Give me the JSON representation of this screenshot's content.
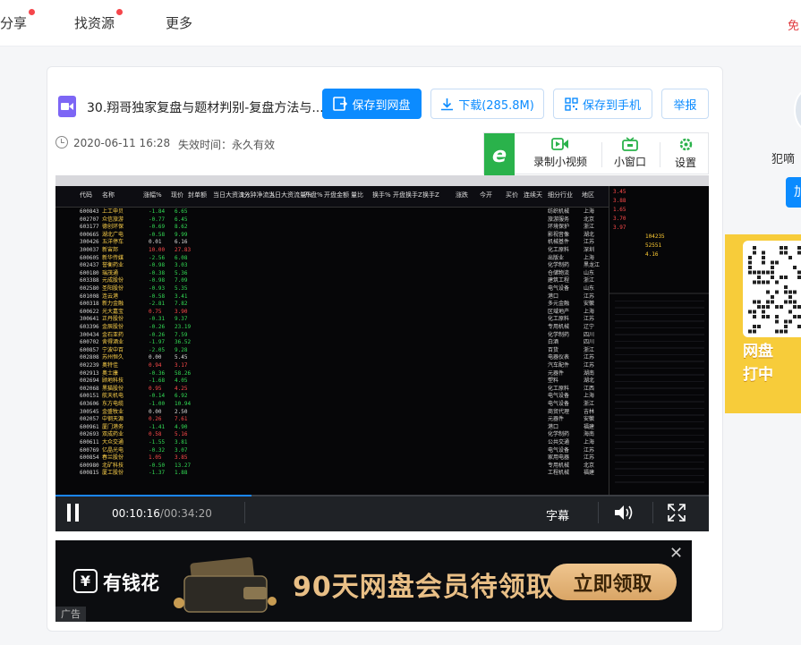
{
  "topnav": {
    "items": [
      {
        "label": "分享",
        "dot": true
      },
      {
        "label": "找资源",
        "dot": true
      },
      {
        "label": "更多",
        "dot": false
      }
    ],
    "right_link": "免"
  },
  "file": {
    "title": "30.翔哥独家复盘与题材判别-复盘方法与...",
    "date": "2020-06-11 16:28",
    "expiry": "失效时间：永久有效"
  },
  "actions": {
    "save_to_pan": "保存到网盘",
    "download": "下载(285.8M)",
    "save_to_phone": "保存到手机",
    "report": "举报"
  },
  "tools": {
    "record": "录制小视频",
    "mini_window": "小窗口",
    "settings": "设置"
  },
  "player": {
    "current_time": "00:10:16",
    "duration": "/00:34:20",
    "subtitle_label": "字幕",
    "progress": 0.3
  },
  "video_frame": {
    "headers": [
      "代码",
      "名称",
      "涨幅%",
      "现价",
      "封单额",
      "当日大资流入",
      "3分钟净流入",
      "当日大资流量%",
      "开盘%",
      "开盘金额",
      "量比",
      "换手%",
      "开盘换手Z",
      "换手Z",
      "涨跌",
      "今开",
      "买价",
      "连续天",
      "细分行业",
      "地区"
    ],
    "rows": [
      {
        "code": "600843",
        "name": "上工申贝",
        "pct": "-1.84",
        "price": "6.65",
        "ind": "纺织机械",
        "region": "上海"
      },
      {
        "code": "002707",
        "name": "众信旅游",
        "pct": "-0.77",
        "price": "6.45",
        "ind": "旅游服务",
        "region": "北京"
      },
      {
        "code": "603177",
        "name": "德创环保",
        "pct": "-0.69",
        "price": "8.62",
        "ind": "环境保护",
        "region": "浙江"
      },
      {
        "code": "000665",
        "name": "湖北广电",
        "pct": "-0.58",
        "price": "9.99",
        "ind": "影视音像",
        "region": "湖北"
      },
      {
        "code": "300426",
        "name": "五洋停车",
        "pct": "0.01",
        "price": "6.16",
        "ind": "机械基件",
        "region": "江苏"
      },
      {
        "code": "300037",
        "name": "新宙邦",
        "pct": "10.00",
        "price": "27.83",
        "ind": "化工原料",
        "region": "深圳"
      },
      {
        "code": "600605",
        "name": "新华传媒",
        "pct": "-2.56",
        "price": "6.08",
        "ind": "出版业",
        "region": "上海"
      },
      {
        "code": "002437",
        "name": "誉衡药业",
        "pct": "-0.98",
        "price": "3.03",
        "ind": "化学制药",
        "region": "黑龙江"
      },
      {
        "code": "600180",
        "name": "瑞茂通",
        "pct": "-0.38",
        "price": "5.36",
        "ind": "仓储物流",
        "region": "山东"
      },
      {
        "code": "603388",
        "name": "元成股份",
        "pct": "-0.98",
        "price": "7.09",
        "ind": "建筑工程",
        "region": "浙江"
      },
      {
        "code": "002580",
        "name": "圣阳股份",
        "pct": "-0.93",
        "price": "5.35",
        "ind": "电气设备",
        "region": "山东"
      },
      {
        "code": "601008",
        "name": "连云港",
        "pct": "-0.58",
        "price": "3.41",
        "ind": "港口",
        "region": "江苏"
      },
      {
        "code": "600318",
        "name": "新力金融",
        "pct": "-2.81",
        "price": "7.82",
        "ind": "多元金融",
        "region": "安徽"
      },
      {
        "code": "600622",
        "name": "光大嘉宝",
        "pct": "0.75",
        "price": "3.90",
        "ind": "区域地产",
        "region": "上海"
      },
      {
        "code": "300641",
        "name": "正丹股份",
        "pct": "-0.31",
        "price": "9.37",
        "ind": "化工原料",
        "region": "江苏"
      },
      {
        "code": "603396",
        "name": "金辰股份",
        "pct": "-0.26",
        "price": "23.19",
        "ind": "专用机械",
        "region": "辽宁"
      },
      {
        "code": "300434",
        "name": "金石亚药",
        "pct": "-0.26",
        "price": "7.59",
        "ind": "化学制药",
        "region": "四川"
      },
      {
        "code": "600702",
        "name": "舍得酒业",
        "pct": "-1.97",
        "price": "36.52",
        "ind": "白酒",
        "region": "四川"
      },
      {
        "code": "600857",
        "name": "宁波中百",
        "pct": "-2.05",
        "price": "9.28",
        "ind": "百货",
        "region": "浙江"
      },
      {
        "code": "002808",
        "name": "苏州恒久",
        "pct": "0.00",
        "price": "5.45",
        "ind": "电器仪表",
        "region": "江苏"
      },
      {
        "code": "002239",
        "name": "奥特佳",
        "pct": "0.94",
        "price": "3.17",
        "ind": "汽车配件",
        "region": "江苏"
      },
      {
        "code": "002913",
        "name": "奥士康",
        "pct": "-0.36",
        "price": "58.26",
        "ind": "元器件",
        "region": "湖南"
      },
      {
        "code": "002694",
        "name": "顾地科技",
        "pct": "-1.68",
        "price": "4.05",
        "ind": "塑料",
        "region": "湖北"
      },
      {
        "code": "002068",
        "name": "黑猫股份",
        "pct": "0.95",
        "price": "4.25",
        "ind": "化工原料",
        "region": "江西"
      },
      {
        "code": "600151",
        "name": "航天机电",
        "pct": "-0.14",
        "price": "6.92",
        "ind": "电气设备",
        "region": "上海"
      },
      {
        "code": "603606",
        "name": "东方电缆",
        "pct": "-1.00",
        "price": "10.94",
        "ind": "电气设备",
        "region": "浙江"
      },
      {
        "code": "300545",
        "name": "金盛牧业",
        "pct": "0.00",
        "price": "2.50",
        "ind": "商贸代理",
        "region": "吉林"
      },
      {
        "code": "002057",
        "name": "中钢天源",
        "pct": "0.26",
        "price": "7.61",
        "ind": "元器件",
        "region": "安徽"
      },
      {
        "code": "600961",
        "name": "厦门港务",
        "pct": "-1.41",
        "price": "4.90",
        "ind": "港口",
        "region": "福建"
      },
      {
        "code": "002693",
        "name": "双成药业",
        "pct": "0.58",
        "price": "5.16",
        "ind": "化学制药",
        "region": "海南"
      },
      {
        "code": "600611",
        "name": "大众交通",
        "pct": "-1.55",
        "price": "3.81",
        "ind": "公共交通",
        "region": "上海"
      },
      {
        "code": "600769",
        "name": "亿晶光电",
        "pct": "-0.32",
        "price": "3.07",
        "ind": "电气设备",
        "region": "江苏"
      },
      {
        "code": "600854",
        "name": "春兰股份",
        "pct": "1.05",
        "price": "3.85",
        "ind": "家用电器",
        "region": "江苏"
      },
      {
        "code": "600980",
        "name": "北矿科技",
        "pct": "-0.50",
        "price": "13.27",
        "ind": "专用机械",
        "region": "北京"
      },
      {
        "code": "600815",
        "name": "厦工股份",
        "pct": "-1.37",
        "price": "1.88",
        "ind": "工程机械",
        "region": "福建"
      }
    ]
  },
  "ad": {
    "brand": "有钱花",
    "headline": "90天网盘会员待领取",
    "cta": "立即领取",
    "label": "广告"
  },
  "sidebar": {
    "username": "犯嘀",
    "follow_label": "加",
    "promo_text_1": "网盘",
    "promo_text_2": "打中"
  },
  "colors": {
    "primary": "#0b8bff",
    "record_green": "#2ab24b",
    "ad_gold": "#e9bf86"
  }
}
